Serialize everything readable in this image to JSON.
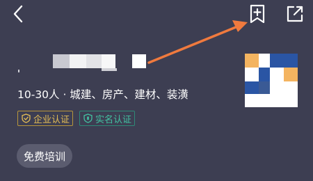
{
  "header": {
    "back_icon": "chevron-left-icon",
    "bookmark_icon": "bookmark-add-icon",
    "share_icon": "share-external-icon"
  },
  "annotation": {
    "arrow_color": "#f07a3e"
  },
  "company": {
    "description": "10-30人 · 城建、房产、建材、装潢",
    "badges": {
      "enterprise": "企业认证",
      "realname": "实名认证"
    },
    "training_label": "免费培训"
  },
  "colors": {
    "background": "#3d3e52",
    "enterprise_badge": "#e6bf55",
    "realname_badge": "#42c2a2",
    "logo_blue": "#2a55a4",
    "logo_orange": "#f4b460"
  }
}
